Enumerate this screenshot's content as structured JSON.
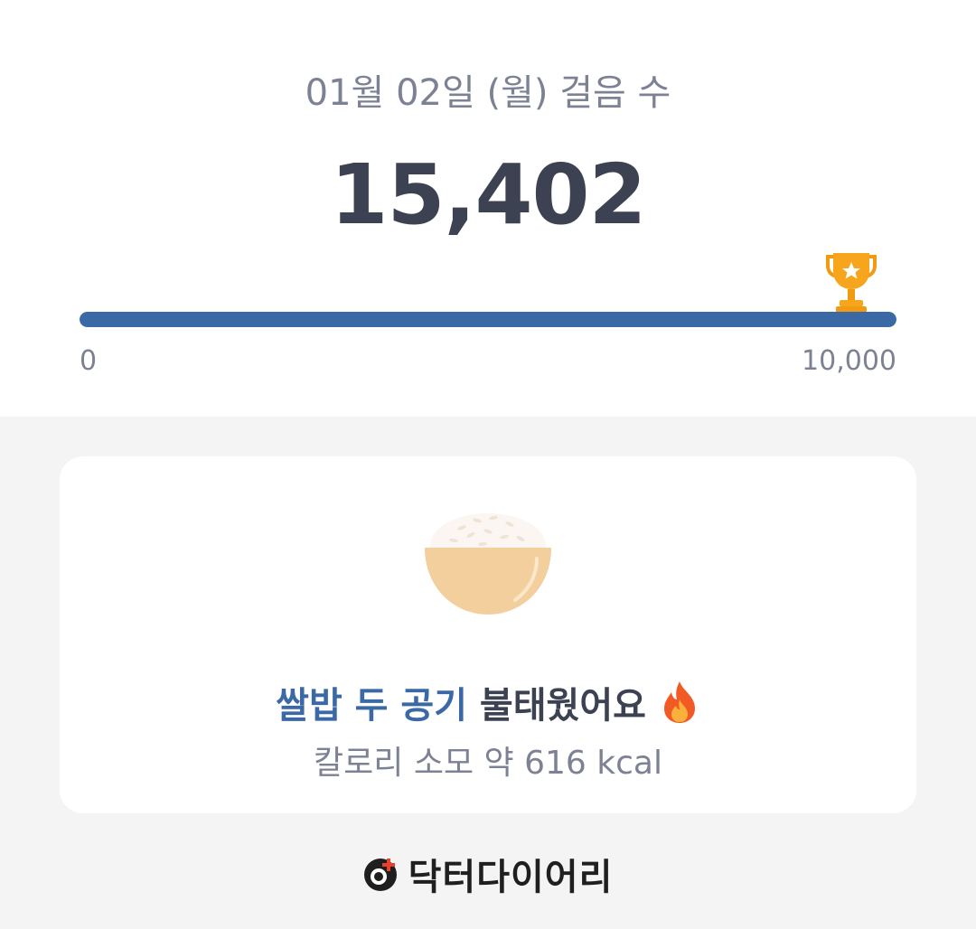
{
  "summary": {
    "date_label": "01월 02일 (월) 걸음 수",
    "steps": "15,402",
    "goal_progress": 1.0,
    "scale_min": "0",
    "scale_max": "10,000",
    "bar_color": "#3b69a6",
    "goal_icon": "trophy-icon"
  },
  "card": {
    "highlight": "쌀밥 두 공기",
    "headline_rest": " 불태웠어요 ",
    "emoji_icon": "fire-icon",
    "calories": "칼로리 소모 약 616 kcal",
    "illustration": "rice-bowl-icon",
    "highlight_color": "#3b69a6"
  },
  "brand": {
    "name": "닥터다이어리",
    "logo_icon": "doctor-diary-logo-icon"
  }
}
